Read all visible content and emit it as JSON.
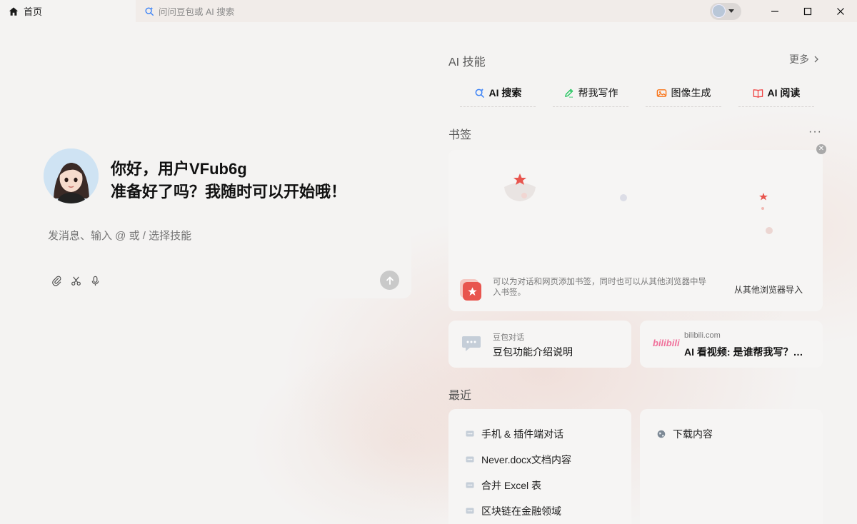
{
  "titlebar": {
    "home_tab": "首页",
    "search_tab": "问问豆包或 AI 搜索"
  },
  "greeting": {
    "line1": "你好，用户VFub6g",
    "line2": "准备好了吗？我随时可以开始哦！"
  },
  "composer": {
    "placeholder": "发消息、输入 @ 或 / 选择技能"
  },
  "skills_section": {
    "title": "AI 技能",
    "more": "更多",
    "items": [
      {
        "label": "AI 搜索",
        "icon": "ai-search-icon",
        "color": "#3b82f6"
      },
      {
        "label": "帮我写作",
        "icon": "pen-icon",
        "color": "#22c55e"
      },
      {
        "label": "图像生成",
        "icon": "image-icon",
        "color": "#f97316"
      },
      {
        "label": "AI 阅读",
        "icon": "book-icon",
        "color": "#ef4444"
      }
    ]
  },
  "bookmarks": {
    "title": "书签",
    "description": "可以为对话和网页添加书签，同时也可以从其他浏览器中导入书签。",
    "import": "从其他浏览器导入",
    "cards": [
      {
        "small": "豆包对话",
        "big": "豆包功能介绍说明"
      },
      {
        "small": "bilibili.com",
        "big": "AI 看视频: 是谁帮我写？作..."
      }
    ]
  },
  "recent": {
    "title": "最近",
    "items": [
      {
        "label": "手机 & 插件端对话"
      },
      {
        "label": "Never.docx文档内容"
      },
      {
        "label": "合并 Excel 表"
      },
      {
        "label": "区块链在金融领域"
      }
    ],
    "downloads": "下载内容"
  }
}
